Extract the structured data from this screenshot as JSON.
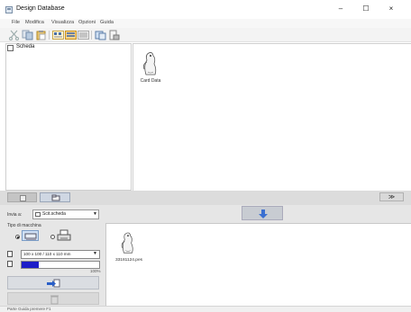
{
  "window": {
    "title": "Design Database",
    "controls": {
      "minimize": "–",
      "maximize": "☐",
      "close": "×"
    }
  },
  "menu": [
    "File",
    "Modifica",
    "Visualizza",
    "Opzioni",
    "Guida"
  ],
  "toolbar": {
    "icons": [
      "cut-icon",
      "copy-icon",
      "paste-icon",
      "view-large-icon",
      "view-medium-icon",
      "view-small-icon",
      "import-icon",
      "export-icon"
    ]
  },
  "tree": {
    "root_label": "Scheda"
  },
  "content": {
    "items": [
      {
        "label": "Card Data"
      }
    ]
  },
  "midbar": {
    "collapse_glyph": "≫"
  },
  "send": {
    "label": "Invia a:",
    "destination": "Scit.scheda"
  },
  "machine": {
    "label": "Tipo di macchina",
    "hoop": "100 x 100 / 110 x 110 mm",
    "usage_percent_label": "100%",
    "usage_fraction": 0.22
  },
  "transfer": {
    "files": [
      {
        "label": "33181124.pes"
      }
    ]
  },
  "status": {
    "text": "Parte Guida premere F1"
  }
}
